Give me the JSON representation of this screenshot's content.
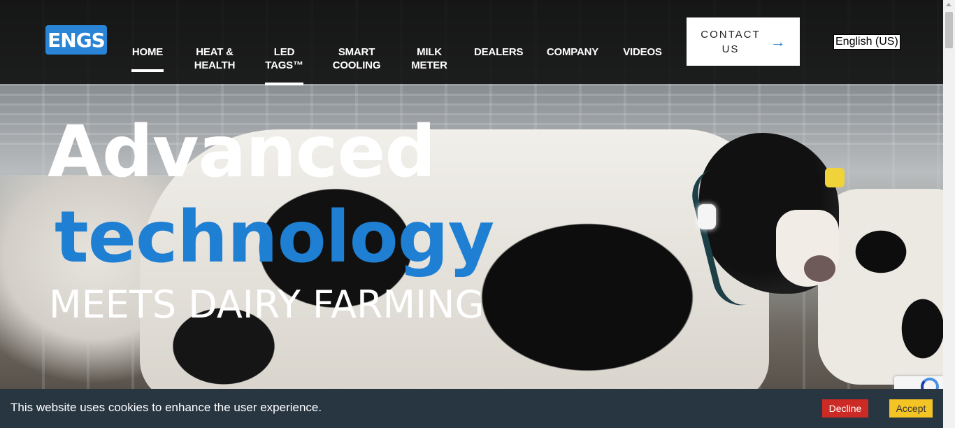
{
  "brand": {
    "logo_text": "ENGS",
    "accent": "#2a84d5"
  },
  "nav": {
    "items": [
      {
        "label": "HOME",
        "active": true
      },
      {
        "label": "HEAT &\nHEALTH"
      },
      {
        "label": "LED\nTAGS™",
        "hover": true
      },
      {
        "label": "SMART\nCOOLING"
      },
      {
        "label": "MILK\nMETER"
      },
      {
        "label": "DEALERS"
      },
      {
        "label": "COMPANY"
      },
      {
        "label": "VIDEOS"
      }
    ],
    "contact": {
      "label": "CONTACT\nUS",
      "icon": "arrow-right-icon"
    },
    "language": "English (US)"
  },
  "hero": {
    "line1": "Advanced",
    "line2": "technology",
    "line3": "MEETS DAIRY FARMING",
    "colors": {
      "highlight": "#1f7fd3"
    }
  },
  "cookie": {
    "message": "This website uses cookies to enhance the user experience.",
    "decline_label": "Decline",
    "accept_label": "Accept",
    "colors": {
      "bar": "#283642",
      "decline": "#cc2a24",
      "accept": "#f4c425"
    }
  }
}
